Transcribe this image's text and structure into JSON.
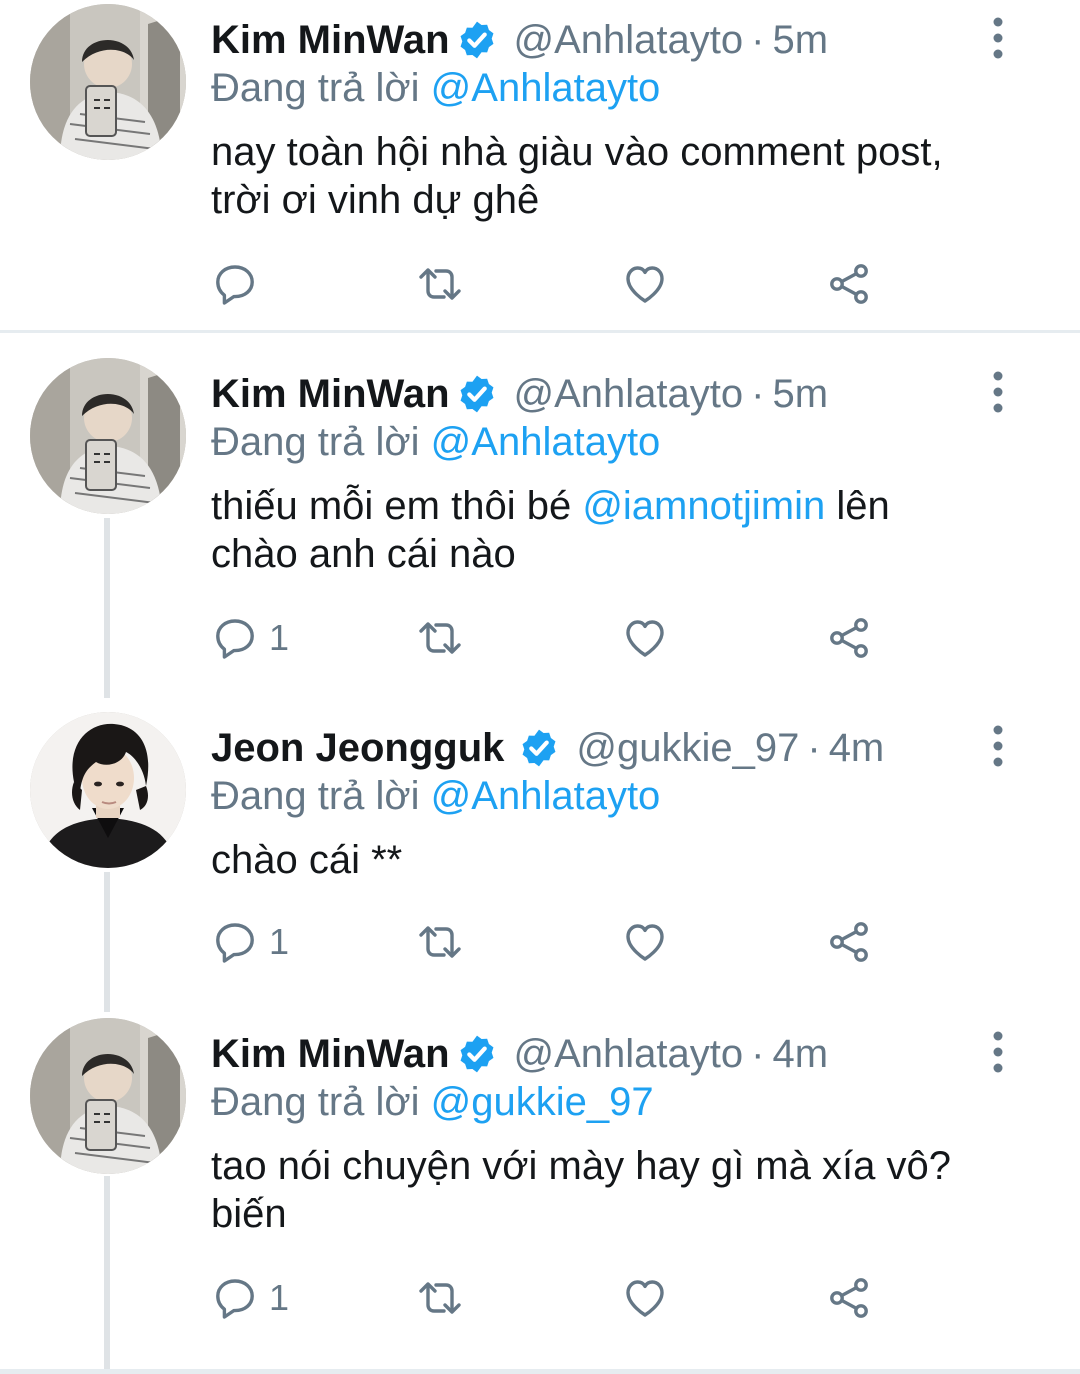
{
  "tweets": [
    {
      "name": "Kim MinWan",
      "handle": "@Anhlatayto",
      "separator": "·",
      "time": "5m",
      "replying_prefix": "Đang trả lời",
      "replying_to": "@Anhlatayto",
      "text_line1": "nay toàn hội nhà giàu vào comment post,",
      "text_line2": "trời ơi vinh dự ghê",
      "reply_count": "",
      "avatar": "avatar-kim-minwan"
    },
    {
      "name": "Kim MinWan",
      "handle": "@Anhlatayto",
      "separator": "·",
      "time": "5m",
      "replying_prefix": "Đang trả lời",
      "replying_to": "@Anhlatayto",
      "text_before": "thiếu mỗi em thôi bé ",
      "text_mention": "@iamnotjimin",
      "text_after": " lên",
      "text_line2": "chào anh cái nào",
      "reply_count": "1",
      "avatar": "avatar-kim-minwan"
    },
    {
      "name": "Jeon Jeongguk",
      "handle": "@gukkie_97",
      "separator": "·",
      "time": "4m",
      "replying_prefix": "Đang trả lời",
      "replying_to": "@Anhlatayto",
      "text_line1": "chào cái **",
      "reply_count": "1",
      "avatar": "avatar-jeon-jeongguk"
    },
    {
      "name": "Kim MinWan",
      "handle": "@Anhlatayto",
      "separator": "·",
      "time": "4m",
      "replying_prefix": "Đang trả lời",
      "replying_to": "@gukkie_97",
      "text_line1": "tao nói chuyện với mày hay gì mà xía vô?",
      "text_line2": "biến",
      "reply_count": "1",
      "avatar": "avatar-kim-minwan"
    }
  ],
  "icons": {
    "reply": "reply-icon",
    "retweet": "retweet-icon",
    "like": "heart-icon",
    "share": "share-icon",
    "more": "more-vertical-icon",
    "verified": "verified-badge-icon"
  },
  "colors": {
    "accent": "#1da1f2",
    "secondary_text": "#657786",
    "primary_text": "#14171a",
    "divider": "#e6ecf0",
    "thread_line": "#dfe3e6"
  }
}
